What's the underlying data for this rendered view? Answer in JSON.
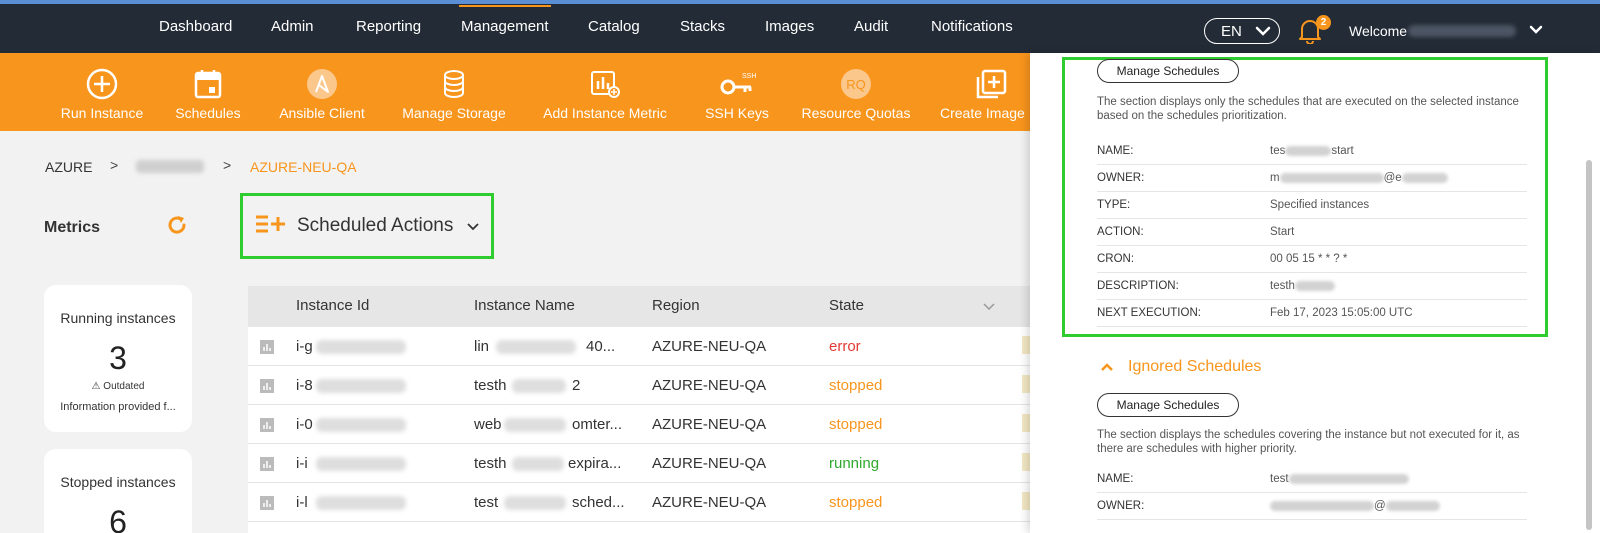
{
  "nav": {
    "items": [
      "Dashboard",
      "Admin",
      "Reporting",
      "Management",
      "Catalog",
      "Stacks",
      "Images",
      "Audit",
      "Notifications"
    ],
    "active": "Management",
    "language": "EN",
    "notification_count": "2",
    "welcome": "Welcome"
  },
  "toolbar": {
    "items": [
      {
        "label": "Run Instance",
        "icon": "plus-circle-icon"
      },
      {
        "label": "Schedules",
        "icon": "calendar-icon"
      },
      {
        "label": "Ansible Client",
        "icon": "ansible-icon"
      },
      {
        "label": "Manage Storage",
        "icon": "database-icon"
      },
      {
        "label": "Add Instance Metric",
        "icon": "chart-add-icon"
      },
      {
        "label": "SSH Keys",
        "icon": "key-icon"
      },
      {
        "label": "Resource Quotas",
        "icon": "rq-icon"
      },
      {
        "label": "Create Image",
        "icon": "add-image-icon"
      }
    ],
    "rq_text": "RQ",
    "ssh_text": "SSH"
  },
  "breadcrumb": {
    "first": "AZURE",
    "last": "AZURE-NEU-QA",
    "separator": ">"
  },
  "metrics": {
    "title": "Metrics"
  },
  "cards": {
    "running": {
      "title": "Running instances",
      "value": "3",
      "outdated": "Outdated",
      "info": "Information provided f..."
    },
    "stopped": {
      "title": "Stopped instances",
      "value": "6"
    }
  },
  "scheduled_actions": {
    "label": "Scheduled Actions"
  },
  "table": {
    "columns": [
      "Instance Id",
      "Instance Name",
      "Region",
      "State"
    ],
    "rows": [
      {
        "id": "i-g",
        "name_prefix": "lin",
        "name_suffix": "40...",
        "region": "AZURE-NEU-QA",
        "state": "error"
      },
      {
        "id": "i-8",
        "name_prefix": "testh",
        "name_suffix": "2",
        "region": "AZURE-NEU-QA",
        "state": "stopped"
      },
      {
        "id": "i-0",
        "name_prefix": "web",
        "name_suffix": "omter...",
        "region": "AZURE-NEU-QA",
        "state": "stopped"
      },
      {
        "id": "i-i",
        "name_prefix": "testh",
        "name_suffix": "expira...",
        "region": "AZURE-NEU-QA",
        "state": "running"
      },
      {
        "id": "i-l",
        "name_prefix": "test",
        "name_suffix": "sched...",
        "region": "AZURE-NEU-QA",
        "state": "stopped"
      }
    ]
  },
  "panel": {
    "manage_label": "Manage Schedules",
    "applied": {
      "description": "The section displays only the schedules that are executed on the selected instance based on the schedules prioritization.",
      "fields": {
        "name_key": "NAME:",
        "name_prefix": "tes",
        "name_suffix": "start",
        "owner_key": "OWNER:",
        "owner_prefix": "m",
        "owner_suffix": "@e",
        "type_key": "TYPE:",
        "type_value": "Specified instances",
        "action_key": "ACTION:",
        "action_value": "Start",
        "cron_key": "CRON:",
        "cron_value": "00 05 15 * * ? *",
        "desc_key": "DESCRIPTION:",
        "desc_prefix": "testh",
        "next_key": "NEXT EXECUTION:",
        "next_value": "Feb 17, 2023 15:05:00 UTC"
      }
    },
    "ignored": {
      "title": "Ignored Schedules",
      "description": "The section displays the schedules covering the instance but not executed for it, as there are schedules with higher priority.",
      "fields": {
        "name_key": "NAME:",
        "name_prefix": "test",
        "owner_key": "OWNER:",
        "owner_suffix": "@"
      }
    }
  },
  "colors": {
    "accent": "#f8951d",
    "nav_bg": "#232b36",
    "highlight": "#2ecc2e",
    "error": "#e53935",
    "running": "#2ea82e"
  }
}
